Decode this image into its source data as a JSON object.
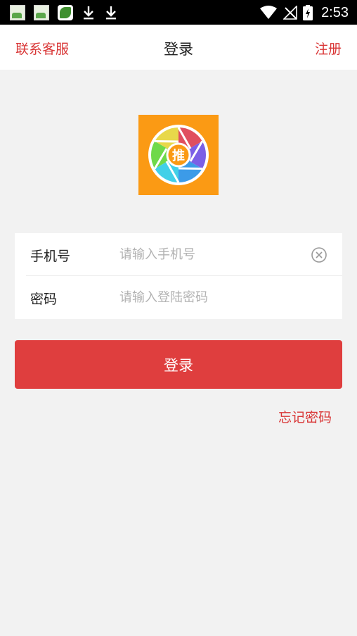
{
  "status_bar": {
    "time": "2:53",
    "icons": [
      "image-notification-icon",
      "image-notification-icon",
      "app-notification-icon",
      "download-icon",
      "download-icon",
      "wifi-icon",
      "no-signal-icon",
      "battery-charging-icon"
    ]
  },
  "header": {
    "left_link": "联系客服",
    "title": "登录",
    "right_link": "注册"
  },
  "logo": {
    "text": "推",
    "background_color": "#fb9a14"
  },
  "form": {
    "phone": {
      "label": "手机号",
      "placeholder": "请输入手机号",
      "value": ""
    },
    "password": {
      "label": "密码",
      "placeholder": "请输入登陆密码",
      "value": ""
    }
  },
  "login_button": {
    "label": "登录",
    "color": "#df3e3e"
  },
  "forgot_password": "忘记密码",
  "colors": {
    "accent": "#d93636",
    "background": "#f2f2f2"
  }
}
